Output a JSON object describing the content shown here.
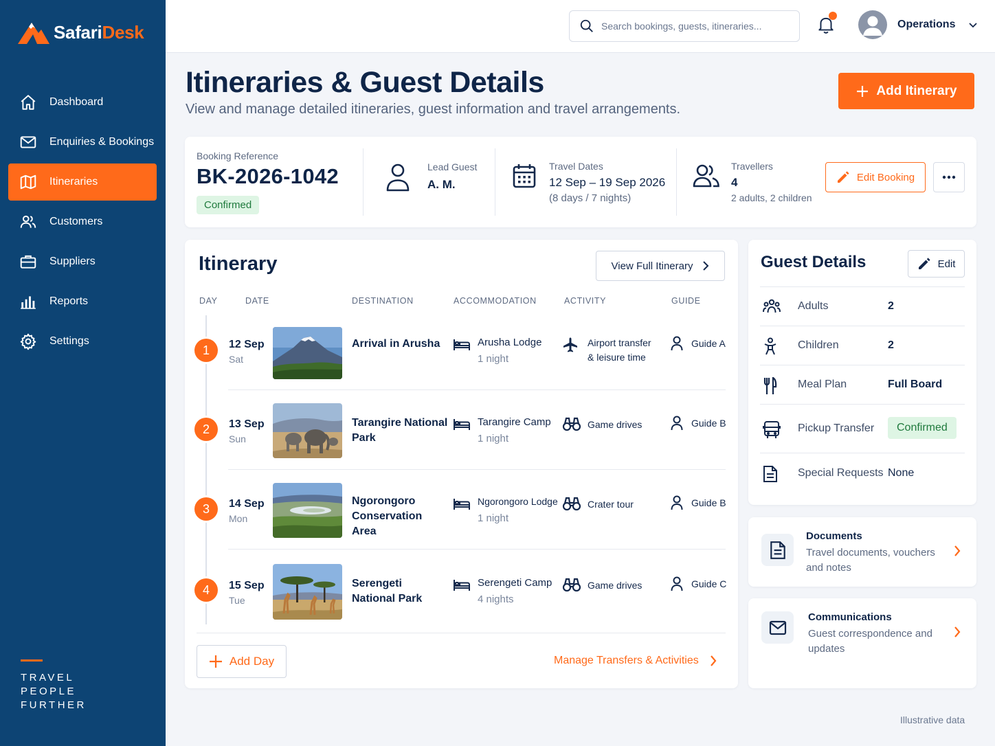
{
  "brand": {
    "name_part1": "Safari",
    "name_part2": "Desk",
    "tagline": [
      "TRAVEL",
      "PEOPLE",
      "FURTHER"
    ],
    "accent_color": "#ff6a1a",
    "sidebar_color": "#0d4474"
  },
  "sidebar": {
    "items": [
      {
        "label": "Dashboard",
        "icon": "home-icon"
      },
      {
        "label": "Enquiries & Bookings",
        "icon": "mail-icon"
      },
      {
        "label": "Itineraries",
        "icon": "map-icon",
        "active": true
      },
      {
        "label": "Customers",
        "icon": "users-icon"
      },
      {
        "label": "Suppliers",
        "icon": "briefcase-icon"
      },
      {
        "label": "Reports",
        "icon": "bar-chart-icon"
      },
      {
        "label": "Settings",
        "icon": "gear-icon"
      }
    ]
  },
  "topbar": {
    "search_placeholder": "Search bookings, guests, itineraries...",
    "user_name": "Operations",
    "notification_dot": true
  },
  "page": {
    "title": "Itineraries & Guest Details",
    "subtitle": "View and manage detailed itineraries, guest information and travel arrangements.",
    "add_button": "Add Itinerary"
  },
  "booking": {
    "ref_label": "Booking Reference",
    "ref": "BK-2026-1042",
    "status": "Confirmed",
    "lead_guest_label": "Lead Guest",
    "lead_guest": "A. M.",
    "dates_label": "Travel Dates",
    "dates": "12 Sep – 19 Sep 2026",
    "duration": "(8 days / 7 nights)",
    "travellers_label": "Travellers",
    "travellers": "4",
    "travellers_detail": "2 adults, 2 children",
    "edit_button": "Edit Booking"
  },
  "itinerary": {
    "title": "Itinerary",
    "view_full": "View Full Itinerary",
    "columns": [
      "DAY",
      "DATE",
      "DESTINATION",
      "ACCOMMODATION",
      "ACTIVITY",
      "GUIDE"
    ],
    "days": [
      {
        "num": "1",
        "date": "12 Sep",
        "weekday": "Sat",
        "destination": "Arrival in Arusha",
        "accommodation": "Arusha Lodge",
        "nights": "1 night",
        "activity": "Airport transfer & leisure time",
        "activity_icon": "plane-icon",
        "guide": "Guide A"
      },
      {
        "num": "2",
        "date": "13 Sep",
        "weekday": "Sun",
        "destination": "Tarangire National Park",
        "accommodation": "Tarangire Camp",
        "nights": "1 night",
        "activity": "Game drives",
        "activity_icon": "binoculars-icon",
        "guide": "Guide B"
      },
      {
        "num": "3",
        "date": "14 Sep",
        "weekday": "Mon",
        "destination": "Ngorongoro Conservation Area",
        "accommodation": "Ngorongoro Lodge",
        "nights": "1 night",
        "activity": "Crater tour",
        "activity_icon": "binoculars-icon",
        "guide": "Guide B"
      },
      {
        "num": "4",
        "date": "15 Sep",
        "weekday": "Tue",
        "destination": "Serengeti National Park",
        "accommodation": "Serengeti Camp",
        "nights": "4 nights",
        "activity": "Game drives",
        "activity_icon": "binoculars-icon",
        "guide": "Guide C"
      }
    ],
    "add_day": "Add Day",
    "manage_link": "Manage Transfers & Activities"
  },
  "guest_details": {
    "title": "Guest Details",
    "edit": "Edit",
    "rows": [
      {
        "label": "Adults",
        "value": "2",
        "icon": "group-icon"
      },
      {
        "label": "Children",
        "value": "2",
        "icon": "child-icon"
      },
      {
        "label": "Meal Plan",
        "value": "Full Board",
        "icon": "utensils-icon"
      },
      {
        "label": "Pickup Transfer",
        "value": "Confirmed",
        "icon": "bus-icon"
      },
      {
        "label": "Special Requests",
        "value": "None",
        "icon": "document-icon"
      }
    ]
  },
  "documents": {
    "title": "Documents",
    "desc": "Travel documents, vouchers and notes"
  },
  "communications": {
    "title": "Communications",
    "desc": "Guest correspondence and updates"
  },
  "footer_note": "Illustrative data"
}
